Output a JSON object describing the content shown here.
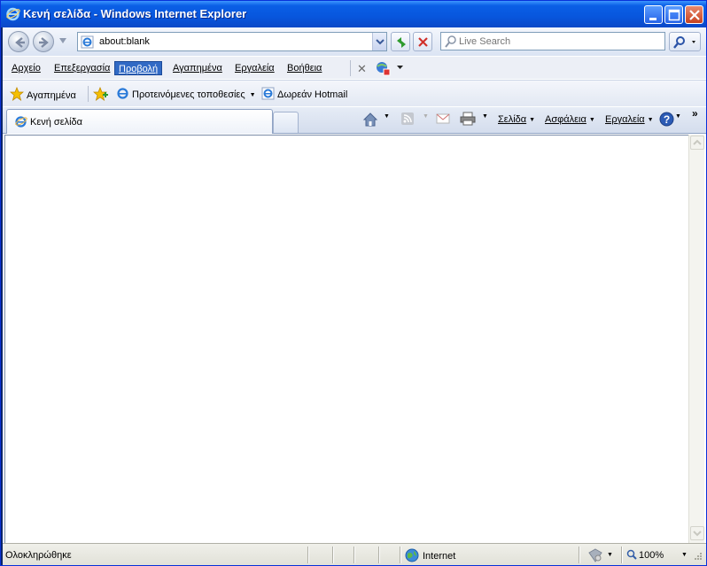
{
  "window": {
    "title": "Κενή σελίδα - Windows Internet Explorer"
  },
  "address_bar": {
    "url": "about:blank"
  },
  "search": {
    "placeholder": "Live Search"
  },
  "menu": {
    "items": [
      "Αρχείο",
      "Επεξεργασία",
      "Προβολή",
      "Αγαπημένα",
      "Εργαλεία",
      "Βοήθεια"
    ],
    "active_index": 2
  },
  "favorites_bar": {
    "favorites_label": "Αγαπημένα",
    "suggested_sites": "Προτεινόμενες τοποθεσίες",
    "hotmail": "Δωρεάν Hotmail"
  },
  "tabs": [
    {
      "label": "Κενή σελίδα"
    }
  ],
  "command_bar": {
    "page": "Σελίδα",
    "safety": "Ασφάλεια",
    "tools": "Εργαλεία"
  },
  "status_bar": {
    "status": "Ολοκληρώθηκε",
    "zone": "Internet",
    "zoom": "100%"
  },
  "colors": {
    "titlebar": "#0a5fe6",
    "menu_active": "#316ac5"
  }
}
